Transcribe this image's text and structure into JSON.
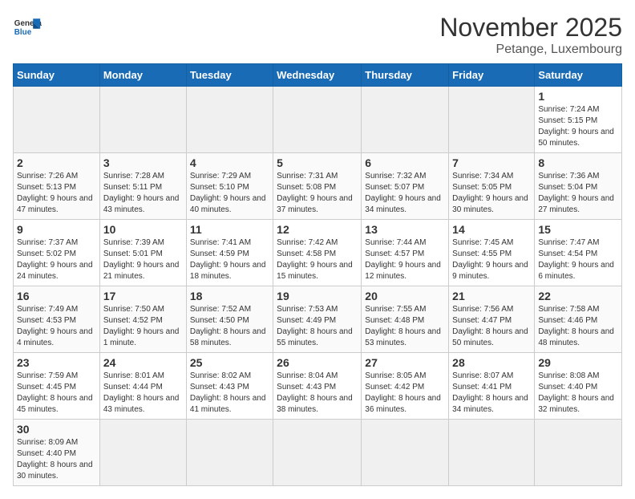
{
  "header": {
    "logo_general": "General",
    "logo_blue": "Blue",
    "month_title": "November 2025",
    "location": "Petange, Luxembourg"
  },
  "days_of_week": [
    "Sunday",
    "Monday",
    "Tuesday",
    "Wednesday",
    "Thursday",
    "Friday",
    "Saturday"
  ],
  "weeks": [
    [
      {
        "day": "",
        "info": ""
      },
      {
        "day": "",
        "info": ""
      },
      {
        "day": "",
        "info": ""
      },
      {
        "day": "",
        "info": ""
      },
      {
        "day": "",
        "info": ""
      },
      {
        "day": "",
        "info": ""
      },
      {
        "day": "1",
        "info": "Sunrise: 7:24 AM\nSunset: 5:15 PM\nDaylight: 9 hours\nand 50 minutes."
      }
    ],
    [
      {
        "day": "2",
        "info": "Sunrise: 7:26 AM\nSunset: 5:13 PM\nDaylight: 9 hours\nand 47 minutes."
      },
      {
        "day": "3",
        "info": "Sunrise: 7:28 AM\nSunset: 5:11 PM\nDaylight: 9 hours\nand 43 minutes."
      },
      {
        "day": "4",
        "info": "Sunrise: 7:29 AM\nSunset: 5:10 PM\nDaylight: 9 hours\nand 40 minutes."
      },
      {
        "day": "5",
        "info": "Sunrise: 7:31 AM\nSunset: 5:08 PM\nDaylight: 9 hours\nand 37 minutes."
      },
      {
        "day": "6",
        "info": "Sunrise: 7:32 AM\nSunset: 5:07 PM\nDaylight: 9 hours\nand 34 minutes."
      },
      {
        "day": "7",
        "info": "Sunrise: 7:34 AM\nSunset: 5:05 PM\nDaylight: 9 hours\nand 30 minutes."
      },
      {
        "day": "8",
        "info": "Sunrise: 7:36 AM\nSunset: 5:04 PM\nDaylight: 9 hours\nand 27 minutes."
      }
    ],
    [
      {
        "day": "9",
        "info": "Sunrise: 7:37 AM\nSunset: 5:02 PM\nDaylight: 9 hours\nand 24 minutes."
      },
      {
        "day": "10",
        "info": "Sunrise: 7:39 AM\nSunset: 5:01 PM\nDaylight: 9 hours\nand 21 minutes."
      },
      {
        "day": "11",
        "info": "Sunrise: 7:41 AM\nSunset: 4:59 PM\nDaylight: 9 hours\nand 18 minutes."
      },
      {
        "day": "12",
        "info": "Sunrise: 7:42 AM\nSunset: 4:58 PM\nDaylight: 9 hours\nand 15 minutes."
      },
      {
        "day": "13",
        "info": "Sunrise: 7:44 AM\nSunset: 4:57 PM\nDaylight: 9 hours\nand 12 minutes."
      },
      {
        "day": "14",
        "info": "Sunrise: 7:45 AM\nSunset: 4:55 PM\nDaylight: 9 hours\nand 9 minutes."
      },
      {
        "day": "15",
        "info": "Sunrise: 7:47 AM\nSunset: 4:54 PM\nDaylight: 9 hours\nand 6 minutes."
      }
    ],
    [
      {
        "day": "16",
        "info": "Sunrise: 7:49 AM\nSunset: 4:53 PM\nDaylight: 9 hours\nand 4 minutes."
      },
      {
        "day": "17",
        "info": "Sunrise: 7:50 AM\nSunset: 4:52 PM\nDaylight: 9 hours\nand 1 minute."
      },
      {
        "day": "18",
        "info": "Sunrise: 7:52 AM\nSunset: 4:50 PM\nDaylight: 8 hours\nand 58 minutes."
      },
      {
        "day": "19",
        "info": "Sunrise: 7:53 AM\nSunset: 4:49 PM\nDaylight: 8 hours\nand 55 minutes."
      },
      {
        "day": "20",
        "info": "Sunrise: 7:55 AM\nSunset: 4:48 PM\nDaylight: 8 hours\nand 53 minutes."
      },
      {
        "day": "21",
        "info": "Sunrise: 7:56 AM\nSunset: 4:47 PM\nDaylight: 8 hours\nand 50 minutes."
      },
      {
        "day": "22",
        "info": "Sunrise: 7:58 AM\nSunset: 4:46 PM\nDaylight: 8 hours\nand 48 minutes."
      }
    ],
    [
      {
        "day": "23",
        "info": "Sunrise: 7:59 AM\nSunset: 4:45 PM\nDaylight: 8 hours\nand 45 minutes."
      },
      {
        "day": "24",
        "info": "Sunrise: 8:01 AM\nSunset: 4:44 PM\nDaylight: 8 hours\nand 43 minutes."
      },
      {
        "day": "25",
        "info": "Sunrise: 8:02 AM\nSunset: 4:43 PM\nDaylight: 8 hours\nand 41 minutes."
      },
      {
        "day": "26",
        "info": "Sunrise: 8:04 AM\nSunset: 4:43 PM\nDaylight: 8 hours\nand 38 minutes."
      },
      {
        "day": "27",
        "info": "Sunrise: 8:05 AM\nSunset: 4:42 PM\nDaylight: 8 hours\nand 36 minutes."
      },
      {
        "day": "28",
        "info": "Sunrise: 8:07 AM\nSunset: 4:41 PM\nDaylight: 8 hours\nand 34 minutes."
      },
      {
        "day": "29",
        "info": "Sunrise: 8:08 AM\nSunset: 4:40 PM\nDaylight: 8 hours\nand 32 minutes."
      }
    ],
    [
      {
        "day": "30",
        "info": "Sunrise: 8:09 AM\nSunset: 4:40 PM\nDaylight: 8 hours\nand 30 minutes."
      },
      {
        "day": "",
        "info": ""
      },
      {
        "day": "",
        "info": ""
      },
      {
        "day": "",
        "info": ""
      },
      {
        "day": "",
        "info": ""
      },
      {
        "day": "",
        "info": ""
      },
      {
        "day": "",
        "info": ""
      }
    ]
  ]
}
